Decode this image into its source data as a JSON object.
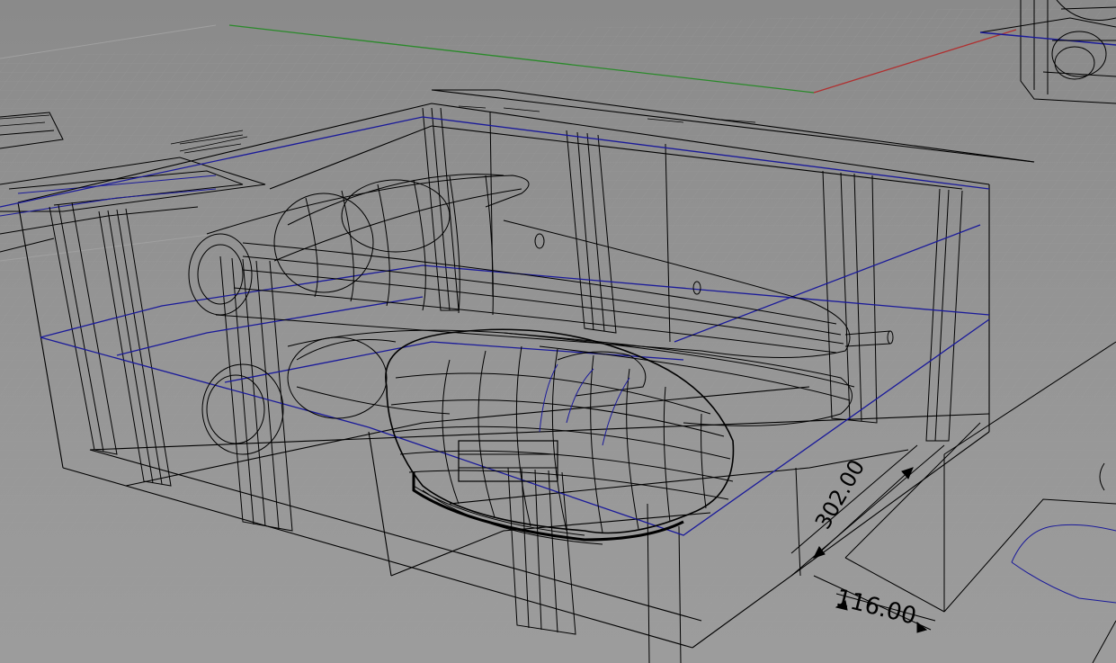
{
  "viewport": {
    "colors": {
      "background": "#929292",
      "grid": "#9a9a9a",
      "wire": "#000000",
      "curve": "#1a1a9a",
      "axis_x": "#b03030",
      "axis_y": "#2a8a2a"
    }
  },
  "dimensions": {
    "height": "302.00",
    "width": "116.00"
  }
}
